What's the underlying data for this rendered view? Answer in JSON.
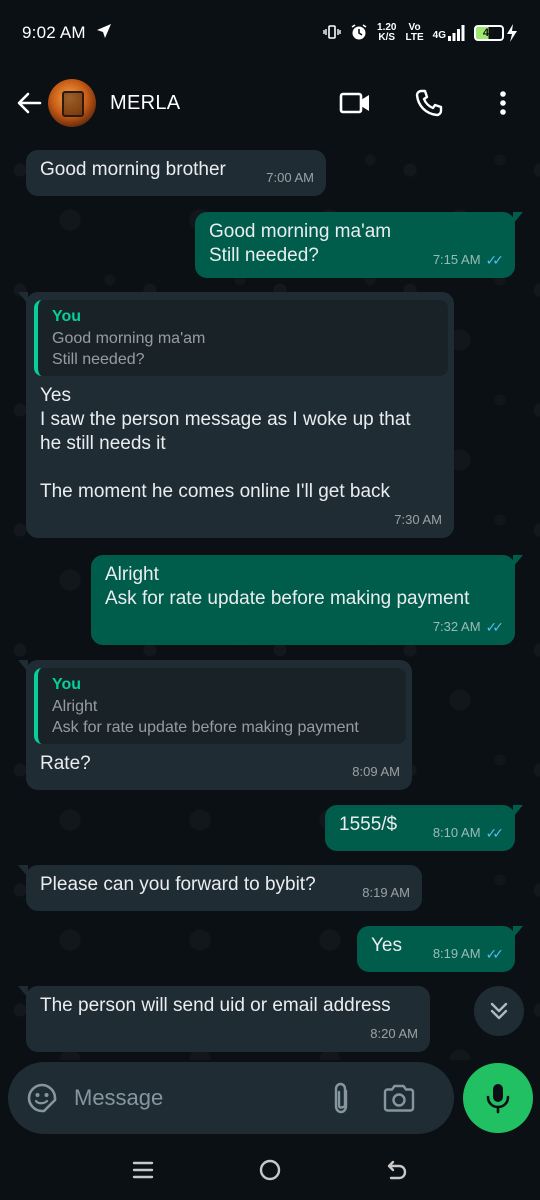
{
  "status_bar": {
    "time": "9:02 AM",
    "net_speed_value": "1.20",
    "net_speed_unit": "K/S",
    "volte_top": "Vo",
    "volte_bottom": "LTE",
    "network": "4G",
    "battery": "49"
  },
  "header": {
    "contact_name": "MERLA"
  },
  "messages": [
    {
      "direction": "in",
      "text": "Good morning brother",
      "time": "7:00 AM"
    },
    {
      "direction": "out",
      "text": "Good morning ma'am\nStill needed?",
      "time": "7:15 AM",
      "status": "read"
    },
    {
      "direction": "in",
      "quote_author": "You",
      "quote_text": "Good morning ma'am\nStill needed?",
      "text": "Yes\nI saw the person message as I woke up that\nhe still needs it\n\nThe moment he comes online I'll get back",
      "time": "7:30 AM"
    },
    {
      "direction": "out",
      "text": "Alright\nAsk for rate update before making payment",
      "time": "7:32 AM",
      "status": "read"
    },
    {
      "direction": "in",
      "quote_author": "You",
      "quote_text": "Alright\nAsk for rate update before making payment",
      "text": "Rate?",
      "time": "8:09 AM"
    },
    {
      "direction": "out",
      "text": "1555/$",
      "time": "8:10 AM",
      "status": "read"
    },
    {
      "direction": "in",
      "text": "Please can you forward to bybit?",
      "time": "8:19 AM"
    },
    {
      "direction": "out",
      "text": "Yes",
      "time": "8:19 AM",
      "status": "read"
    },
    {
      "direction": "in",
      "text": "The person will send uid or email address",
      "time": "8:20 AM"
    }
  ],
  "composer": {
    "placeholder": "Message"
  },
  "colors": {
    "background": "#0b1014",
    "incoming_bubble": "#202c33",
    "outgoing_bubble": "#005c4b",
    "accent_green": "#21c063",
    "read_ticks": "#53bdeb",
    "quote_accent": "#06cf9c"
  },
  "icons": {
    "back": "arrow-left-icon",
    "video": "video-camera-icon",
    "call": "phone-icon",
    "menu": "more-vertical-icon",
    "emoji": "sticker-emoji-icon",
    "attach": "paperclip-icon",
    "camera": "camera-icon",
    "mic": "microphone-icon",
    "scroll": "double-chevron-down-icon"
  }
}
